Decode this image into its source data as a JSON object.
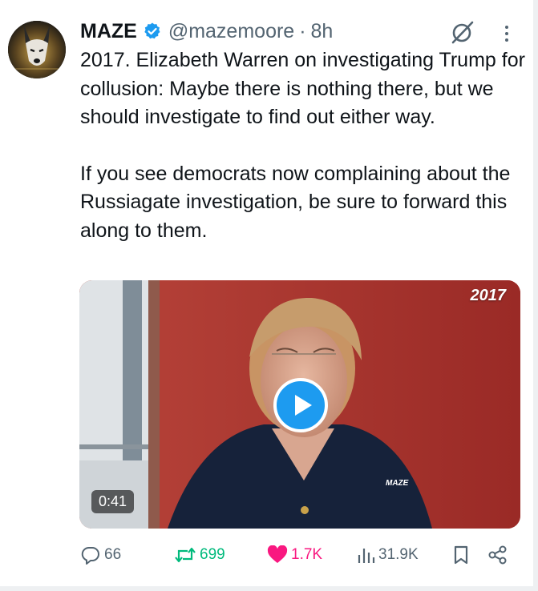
{
  "tweet": {
    "author_name": "MAZE",
    "handle": "@mazemoore",
    "separator": "·",
    "time": "8h",
    "text_paragraphs": [
      "2017. Elizabeth Warren on investigating Trump for collusion: Maybe there is nothing there, but we should investigate to find out either way.",
      "If you see democrats now complaining about the Russiagate investigation, be sure to forward this along to them."
    ]
  },
  "media": {
    "year_label": "2017",
    "watermark": "MAZE",
    "duration": "0:41"
  },
  "actions": {
    "replies": "66",
    "reposts": "699",
    "likes": "1.7K",
    "views": "31.9K"
  },
  "colors": {
    "verified": "#1d9bf0",
    "repost_active": "#00ba7c",
    "like_active": "#f91880",
    "muted": "#536471",
    "play_button": "#1d9bf0"
  },
  "icons": [
    "verified-badge-icon",
    "grok-icon",
    "more-icon",
    "play-icon",
    "reply-icon",
    "repost-icon",
    "like-icon",
    "views-icon",
    "bookmark-icon",
    "share-icon"
  ]
}
